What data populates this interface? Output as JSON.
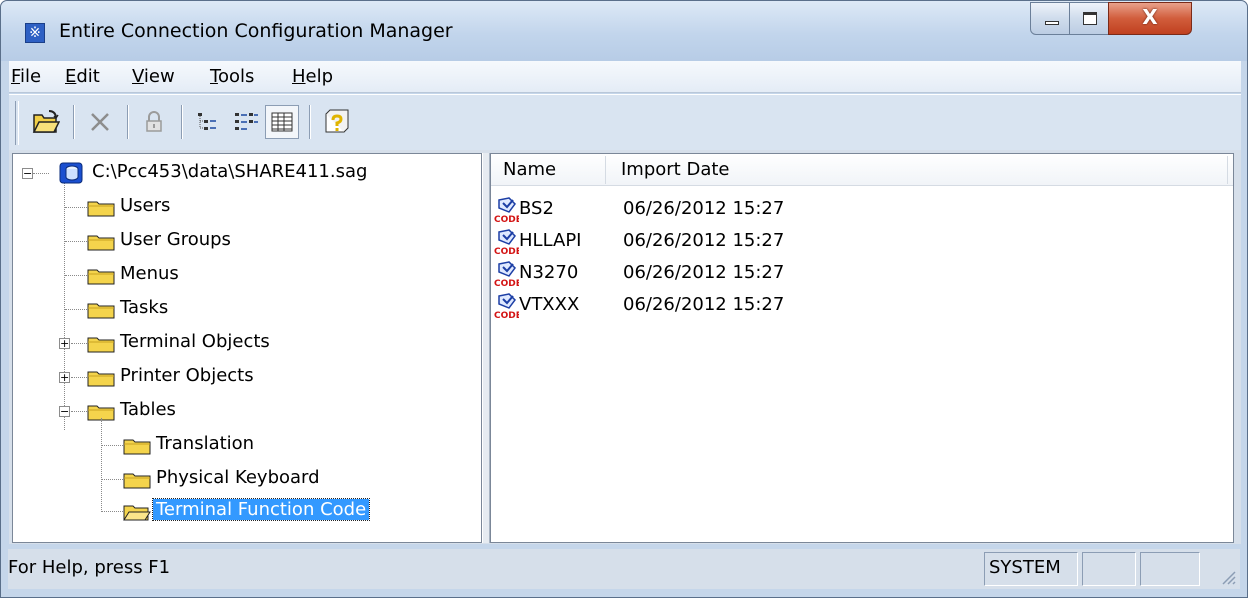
{
  "window": {
    "title": "Entire Connection Configuration Manager",
    "close_glyph": "X"
  },
  "menu": [
    {
      "key": "F",
      "rest": "ile"
    },
    {
      "key": "E",
      "rest": "dit"
    },
    {
      "key": "V",
      "rest": "iew"
    },
    {
      "key": "T",
      "rest": "ools"
    },
    {
      "key": "H",
      "rest": "elp"
    }
  ],
  "toolbar": {
    "icons": [
      "open-folder-icon",
      "delete-icon",
      "lock-icon",
      "tree-view-icon",
      "details-view-icon",
      "list-view-icon",
      "context-help-icon"
    ]
  },
  "tree": {
    "root": "C:\\Pcc453\\data\\SHARE411.sag",
    "items": [
      "Users",
      "User Groups",
      "Menus",
      "Tasks",
      "Terminal Objects",
      "Printer Objects",
      "Tables"
    ],
    "tables_children": [
      "Translation",
      "Physical Keyboard",
      "Terminal Function Code"
    ],
    "selected": "Terminal Function Code"
  },
  "list": {
    "columns": [
      "Name",
      "Import Date"
    ],
    "rows": [
      {
        "name": "BS2",
        "date": "06/26/2012 15:27"
      },
      {
        "name": "HLLAPI",
        "date": "06/26/2012 15:27"
      },
      {
        "name": "N3270",
        "date": "06/26/2012 15:27"
      },
      {
        "name": "VTXXX",
        "date": "06/26/2012 15:27"
      }
    ]
  },
  "status": {
    "help_text": "For Help, press F1",
    "panel1": "SYSTEM",
    "panel2": "",
    "panel3": ""
  },
  "colors": {
    "selection": "#3399ff",
    "folder": "#f4d44c",
    "close_button": "#d15d3c"
  }
}
